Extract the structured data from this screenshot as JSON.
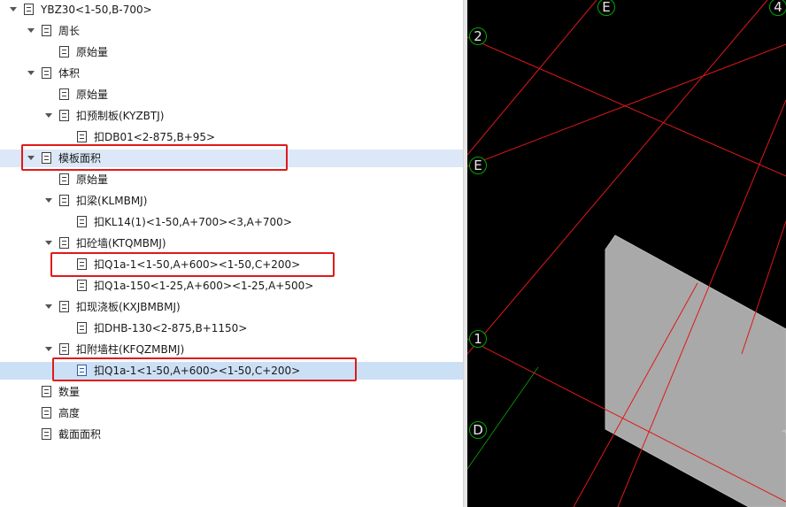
{
  "tree": {
    "items": [
      {
        "label": "YBZ30<1-50,B-700>"
      },
      {
        "label": "周长"
      },
      {
        "label": "原始量"
      },
      {
        "label": "体积"
      },
      {
        "label": "原始量"
      },
      {
        "label": "扣预制板(KYZBTJ)"
      },
      {
        "label": "扣DB01<2-875,B+95>"
      },
      {
        "label": "模板面积"
      },
      {
        "label": "原始量"
      },
      {
        "label": "扣梁(KLMBMJ)"
      },
      {
        "label": "扣KL14(1)<1-50,A+700><3,A+700>"
      },
      {
        "label": "扣砼墙(KTQMBMJ)"
      },
      {
        "label": "扣Q1a-1<1-50,A+600><1-50,C+200>"
      },
      {
        "label": "扣Q1a-150<1-25,A+600><1-25,A+500>"
      },
      {
        "label": "扣现浇板(KXJBMBMJ)"
      },
      {
        "label": "扣DHB-130<2-875,B+1150>"
      },
      {
        "label": "扣附墙柱(KFQZMBMJ)"
      },
      {
        "label": "扣Q1a-1<1-50,A+600><1-50,C+200>"
      },
      {
        "label": "数量"
      },
      {
        "label": "高度"
      },
      {
        "label": "截面面积"
      }
    ]
  },
  "viewport": {
    "axis_labels": [
      "E",
      "4",
      "2",
      "E",
      "1",
      "D"
    ],
    "colors": {
      "grid_red": "#e01818",
      "grid_green": "#0a8a0a",
      "element_gray": "#a9a9a9",
      "background": "#000000"
    }
  }
}
